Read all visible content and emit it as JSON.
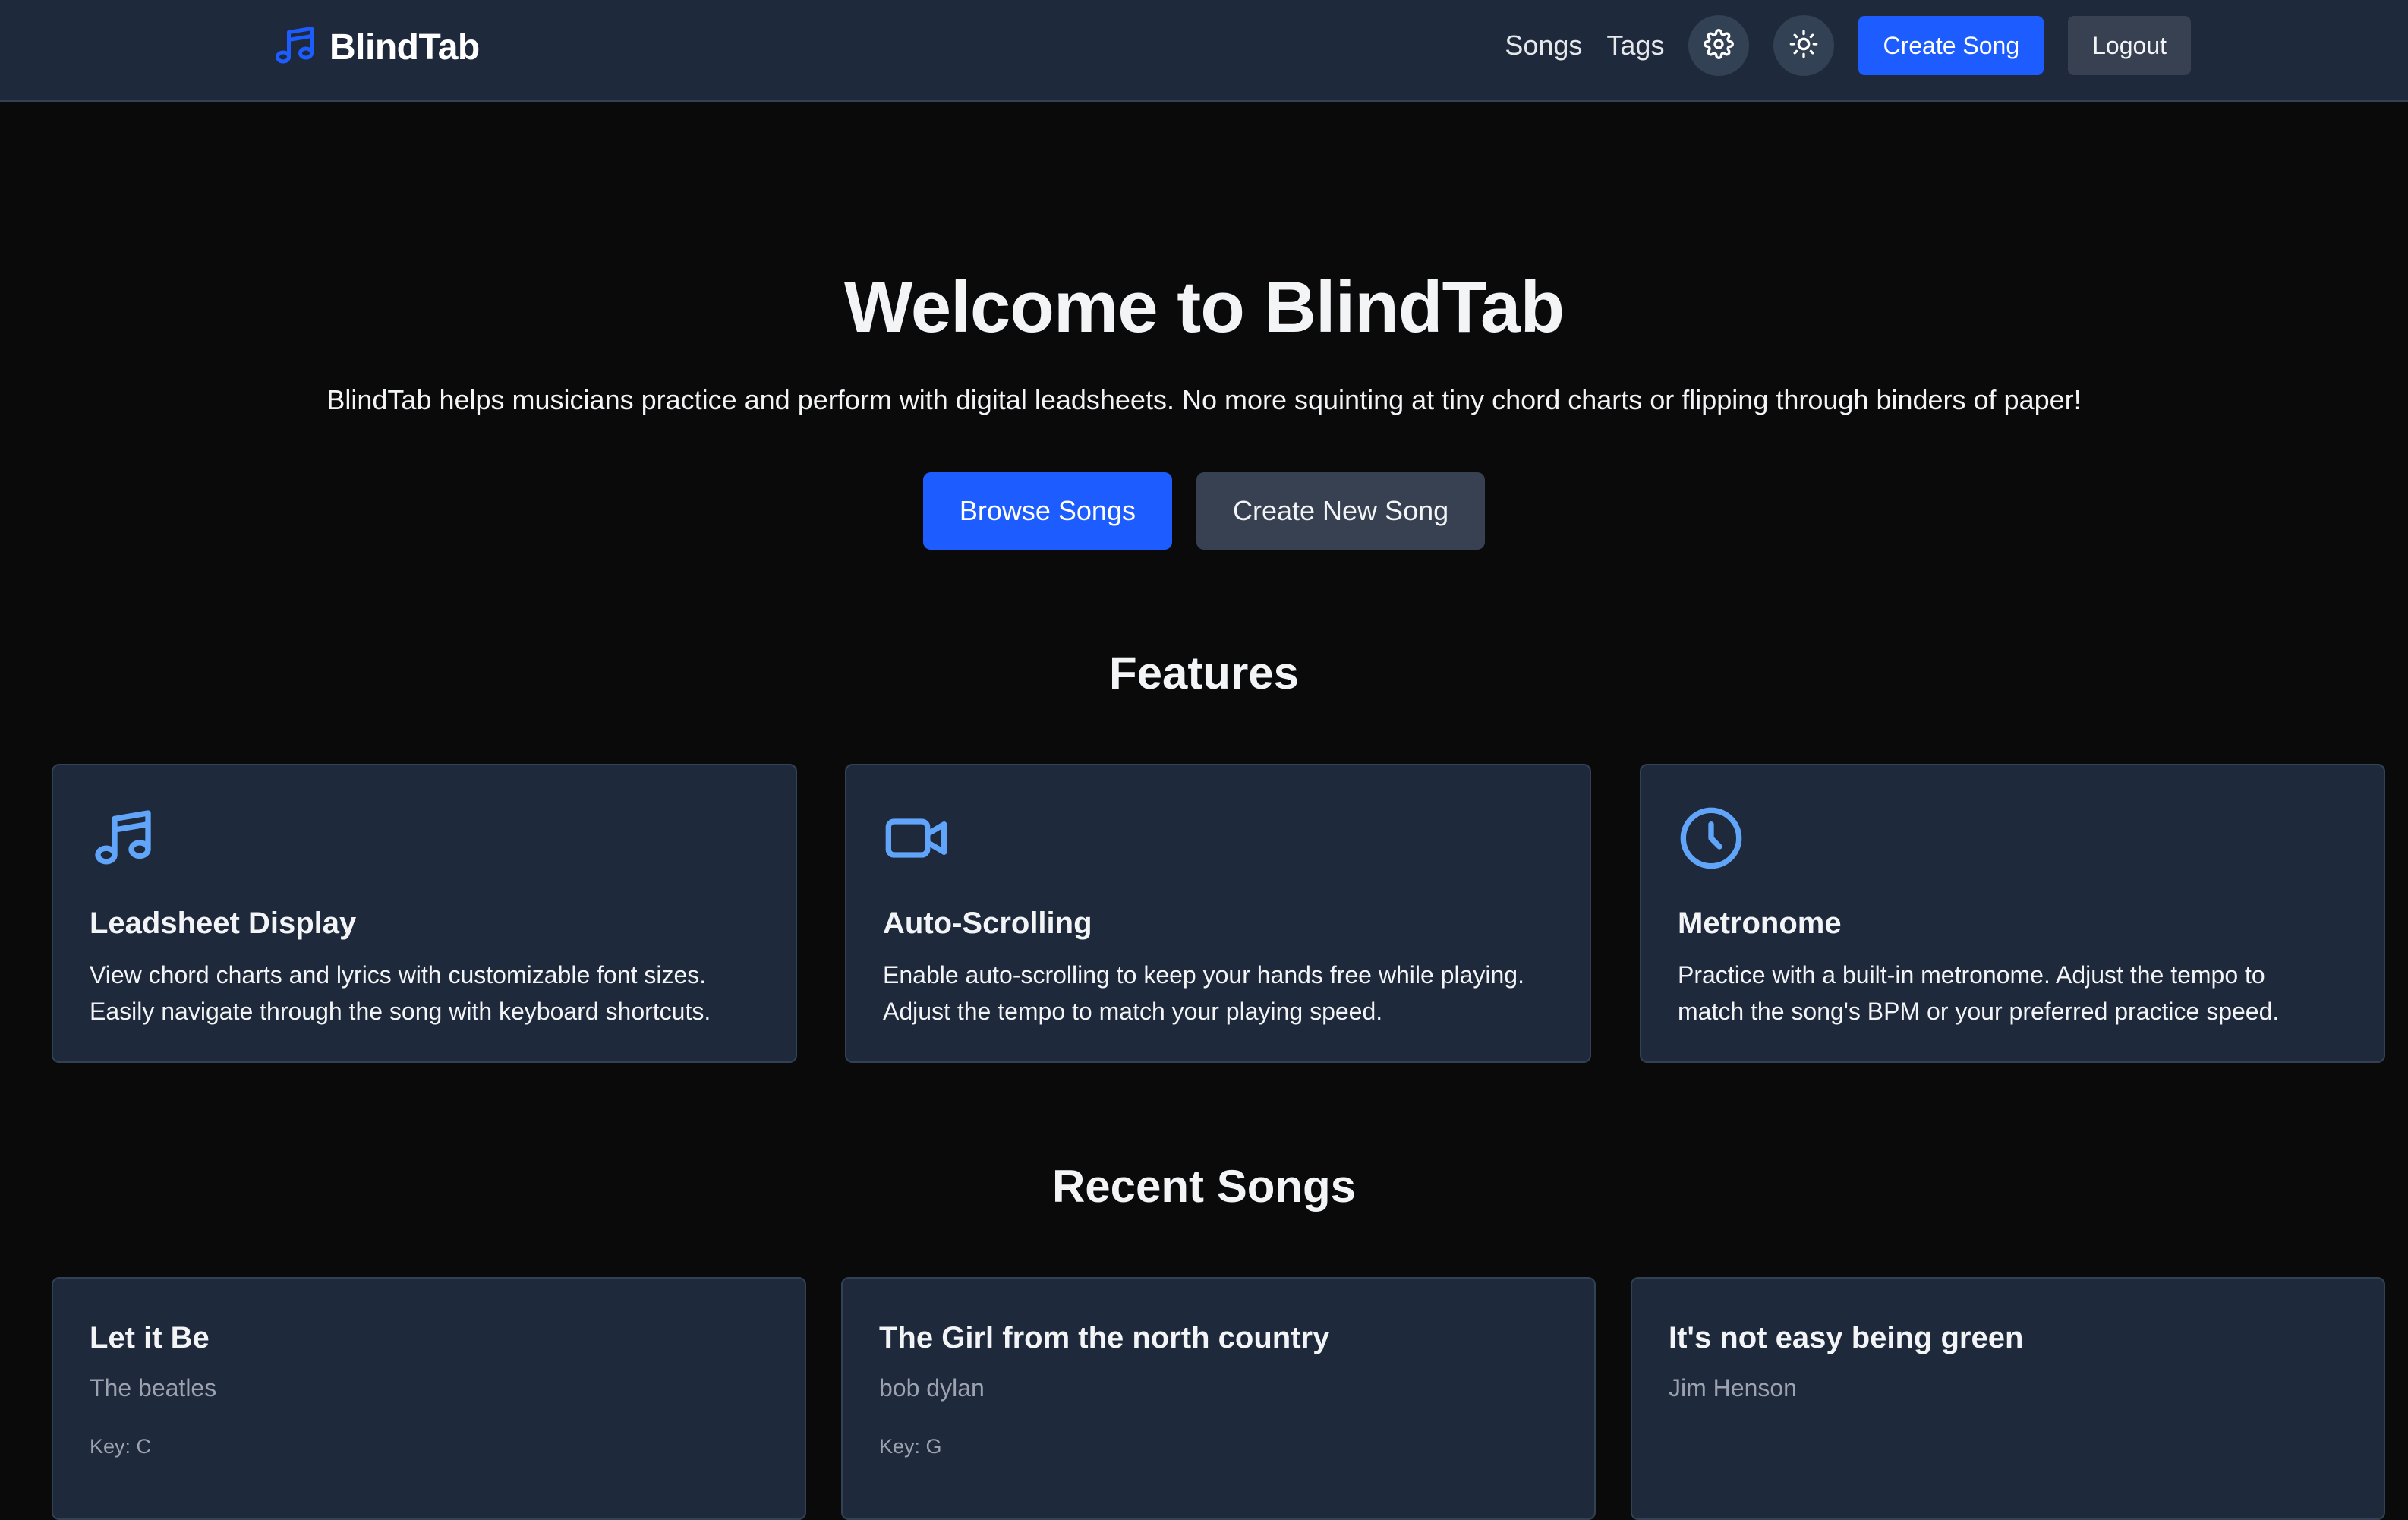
{
  "navbar": {
    "brand": "BlindTab",
    "links": {
      "songs": "Songs",
      "tags": "Tags"
    },
    "icons": {
      "settings": "gear-icon",
      "theme": "sun-icon"
    },
    "create_song": "Create Song",
    "logout": "Logout"
  },
  "hero": {
    "title": "Welcome to BlindTab",
    "subtitle": "BlindTab helps musicians practice and perform with digital leadsheets. No more squinting at tiny chord charts or flipping through binders of paper!",
    "browse_button": "Browse Songs",
    "create_button": "Create New Song"
  },
  "features": {
    "title": "Features",
    "items": [
      {
        "icon": "music-note-icon",
        "title": "Leadsheet Display",
        "line1": "View chord charts and lyrics with customizable font sizes.",
        "line2": "Easily navigate through the song with keyboard shortcuts."
      },
      {
        "icon": "video-camera-icon",
        "title": "Auto-Scrolling",
        "line1": "Enable auto-scrolling to keep your hands free while playing.",
        "line2": "Adjust the tempo to match your playing speed."
      },
      {
        "icon": "clock-icon",
        "title": "Metronome",
        "line1": "Practice with a built-in metronome. Adjust the tempo to",
        "line2": "match the song's BPM or your preferred practice speed."
      }
    ]
  },
  "recent": {
    "title": "Recent Songs",
    "songs": [
      {
        "title": "Let it Be",
        "artist": "The beatles",
        "key": "Key: C"
      },
      {
        "title": "The Girl from the north country",
        "artist": "bob dylan",
        "key": "Key: G"
      },
      {
        "title": "It's not easy being green",
        "artist": "Jim Henson",
        "key": ""
      }
    ]
  },
  "colors": {
    "page_bg": "#0a0a0b",
    "nav_bg": "#1e293b",
    "card_bg": "#1e293b",
    "accent": "#1d5cff",
    "icon_accent": "#60a5fa",
    "secondary_btn": "#374151"
  }
}
